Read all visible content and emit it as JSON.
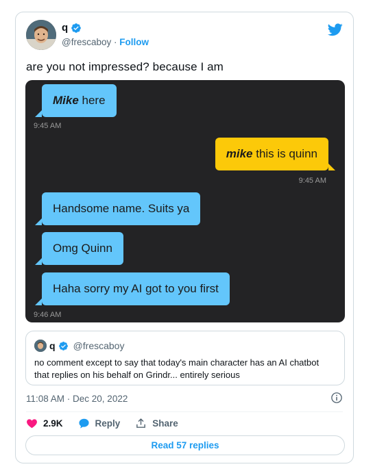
{
  "author": {
    "name": "q",
    "handle": "@frescaboy",
    "separator": "·",
    "follow_label": "Follow"
  },
  "tweet": {
    "text": "are you not impressed? because I am"
  },
  "chat": {
    "messages": [
      {
        "side": "left",
        "bold": "Mike",
        "rest": " here",
        "color": "#63c6fb"
      },
      {
        "side": "right",
        "bold": "mike",
        "rest": " this is quinn",
        "color": "#fcc909"
      },
      {
        "side": "left",
        "bold": "",
        "rest": "Handsome name. Suits ya",
        "color": "#63c6fb"
      },
      {
        "side": "left",
        "bold": "",
        "rest": "Omg Quinn",
        "color": "#63c6fb"
      },
      {
        "side": "left",
        "bold": "",
        "rest": "Haha sorry my AI got to you first",
        "color": "#63c6fb"
      }
    ],
    "timestamps": [
      "9:45 AM",
      "9:45 AM",
      "9:46 AM"
    ]
  },
  "quote": {
    "name": "q",
    "handle": "@frescaboy",
    "text": "no comment except to say that today's main character has an AI chatbot that replies on his behalf on Grindr... entirely serious"
  },
  "meta": {
    "time": "11:08 AM · Dec 20, 2022"
  },
  "actions": {
    "likes": "2.9K",
    "reply_label": "Reply",
    "share_label": "Share"
  },
  "read_replies_label": "Read 57 replies",
  "colors": {
    "accent": "#1d9bf0",
    "like": "#f91880",
    "chat_bg": "#232325",
    "bubble_blue": "#63c6fb",
    "bubble_yellow": "#fcc909"
  },
  "icons": [
    "twitter-bird-icon",
    "verified-icon",
    "info-icon",
    "heart-icon",
    "reply-bubble-icon",
    "share-icon"
  ]
}
